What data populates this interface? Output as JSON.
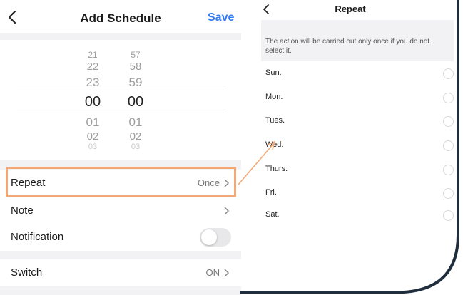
{
  "left": {
    "nav": {
      "back_icon": "chevron-left-icon",
      "title": "Add Schedule",
      "save_label": "Save"
    },
    "picker": {
      "hours": [
        "21",
        "22",
        "23",
        "00",
        "01",
        "02",
        "03"
      ],
      "minutes": [
        "57",
        "58",
        "59",
        "00",
        "01",
        "02",
        "03"
      ],
      "selected_hour": "00",
      "selected_minute": "00"
    },
    "rows": {
      "repeat": {
        "label": "Repeat",
        "value": "Once"
      },
      "note": {
        "label": "Note"
      },
      "notification": {
        "label": "Notification",
        "toggle_on": false
      },
      "switch": {
        "label": "Switch",
        "value": "ON"
      }
    }
  },
  "right": {
    "nav": {
      "back_icon": "chevron-left-icon",
      "title": "Repeat"
    },
    "description": "The action will be carried out only once if you do not select it.",
    "days": [
      "Sun.",
      "Mon.",
      "Tues.",
      "Wed.",
      "Thurs.",
      "Fri.",
      "Sat."
    ]
  },
  "colors": {
    "accent": "#2f7cf6",
    "highlight": "#f2a774",
    "band": "#f2f2f4"
  }
}
